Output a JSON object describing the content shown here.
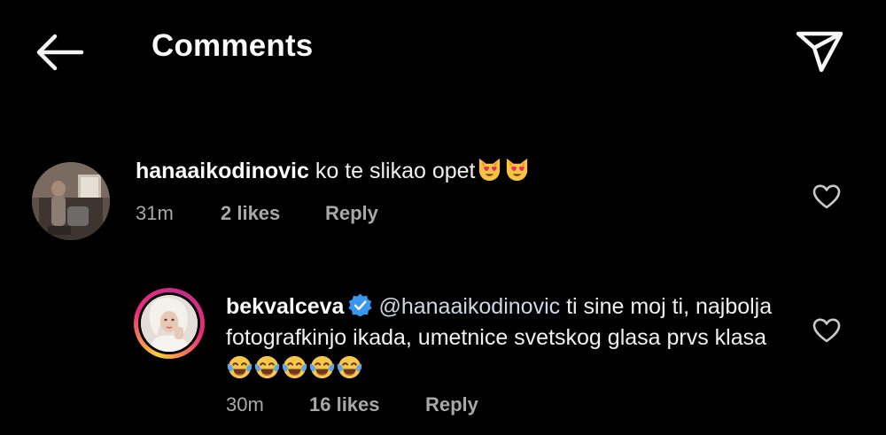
{
  "header": {
    "title": "Comments",
    "back_icon": "arrow-left-icon",
    "send_icon": "paper-plane-icon"
  },
  "comments": [
    {
      "username": "hanaaikodinovic",
      "text": "ko te slikao opet",
      "emojis": [
        "smiling-cat-heart-eyes",
        "smiling-cat-heart-eyes"
      ],
      "time": "31m",
      "likes": "2 likes",
      "reply_label": "Reply",
      "like_icon": "heart-outline-icon"
    },
    {
      "username": "bekvalceva",
      "verified": true,
      "mention": "@hanaaikodinovic",
      "text": " ti sine moj ti, najbolja fotografkinjo ikada, umetnice svetskog glasa prvs klasa",
      "emojis": [
        "face-with-tears-of-joy",
        "face-with-tears-of-joy",
        "face-with-tears-of-joy",
        "face-with-tears-of-joy",
        "face-with-tears-of-joy"
      ],
      "time": "30m",
      "likes": "16 likes",
      "reply_label": "Reply",
      "like_icon": "heart-outline-icon"
    }
  ],
  "colors": {
    "background": "#000000",
    "primary_text": "#f5f5f5",
    "secondary_text": "#a8a8a8",
    "verified_blue": "#3897f0",
    "story_ring_start": "#f9ce34",
    "story_ring_end": "#ee2a7b"
  }
}
